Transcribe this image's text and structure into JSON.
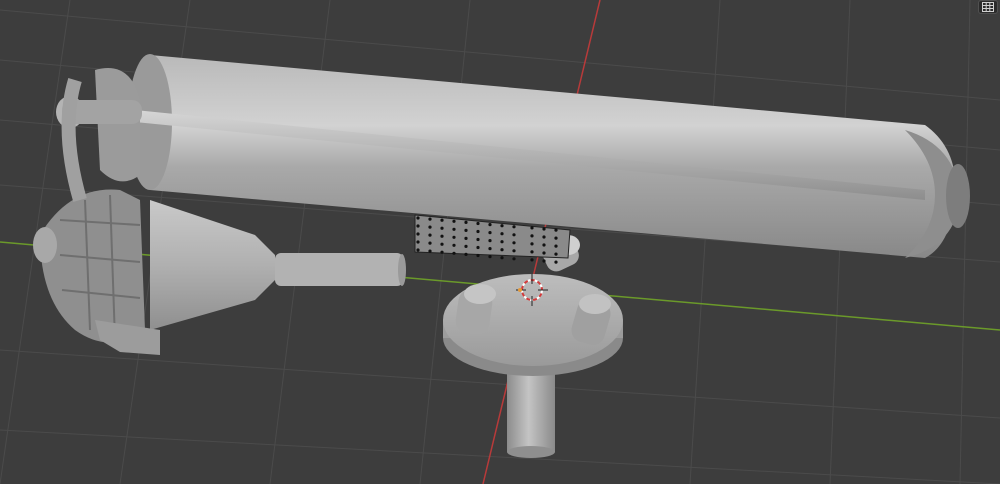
{
  "viewport": {
    "mode": "3D Viewport",
    "shading": "solid",
    "background": "#3d3d3d",
    "grid_color": "#4a4a4a",
    "axis_x_color": "#6b9a2a",
    "axis_y_color": "#b83a3a"
  },
  "scene": {
    "objects": [
      {
        "name_icon": "cylinder-tube-mesh"
      },
      {
        "name_icon": "cone-assembly-mesh"
      },
      {
        "name_icon": "pedestal-mesh"
      },
      {
        "name_icon": "selected-vertex-grid"
      }
    ]
  },
  "overlay": {
    "grid_icon": "grid-icon",
    "cursor_icon": "3d-cursor-icon"
  }
}
